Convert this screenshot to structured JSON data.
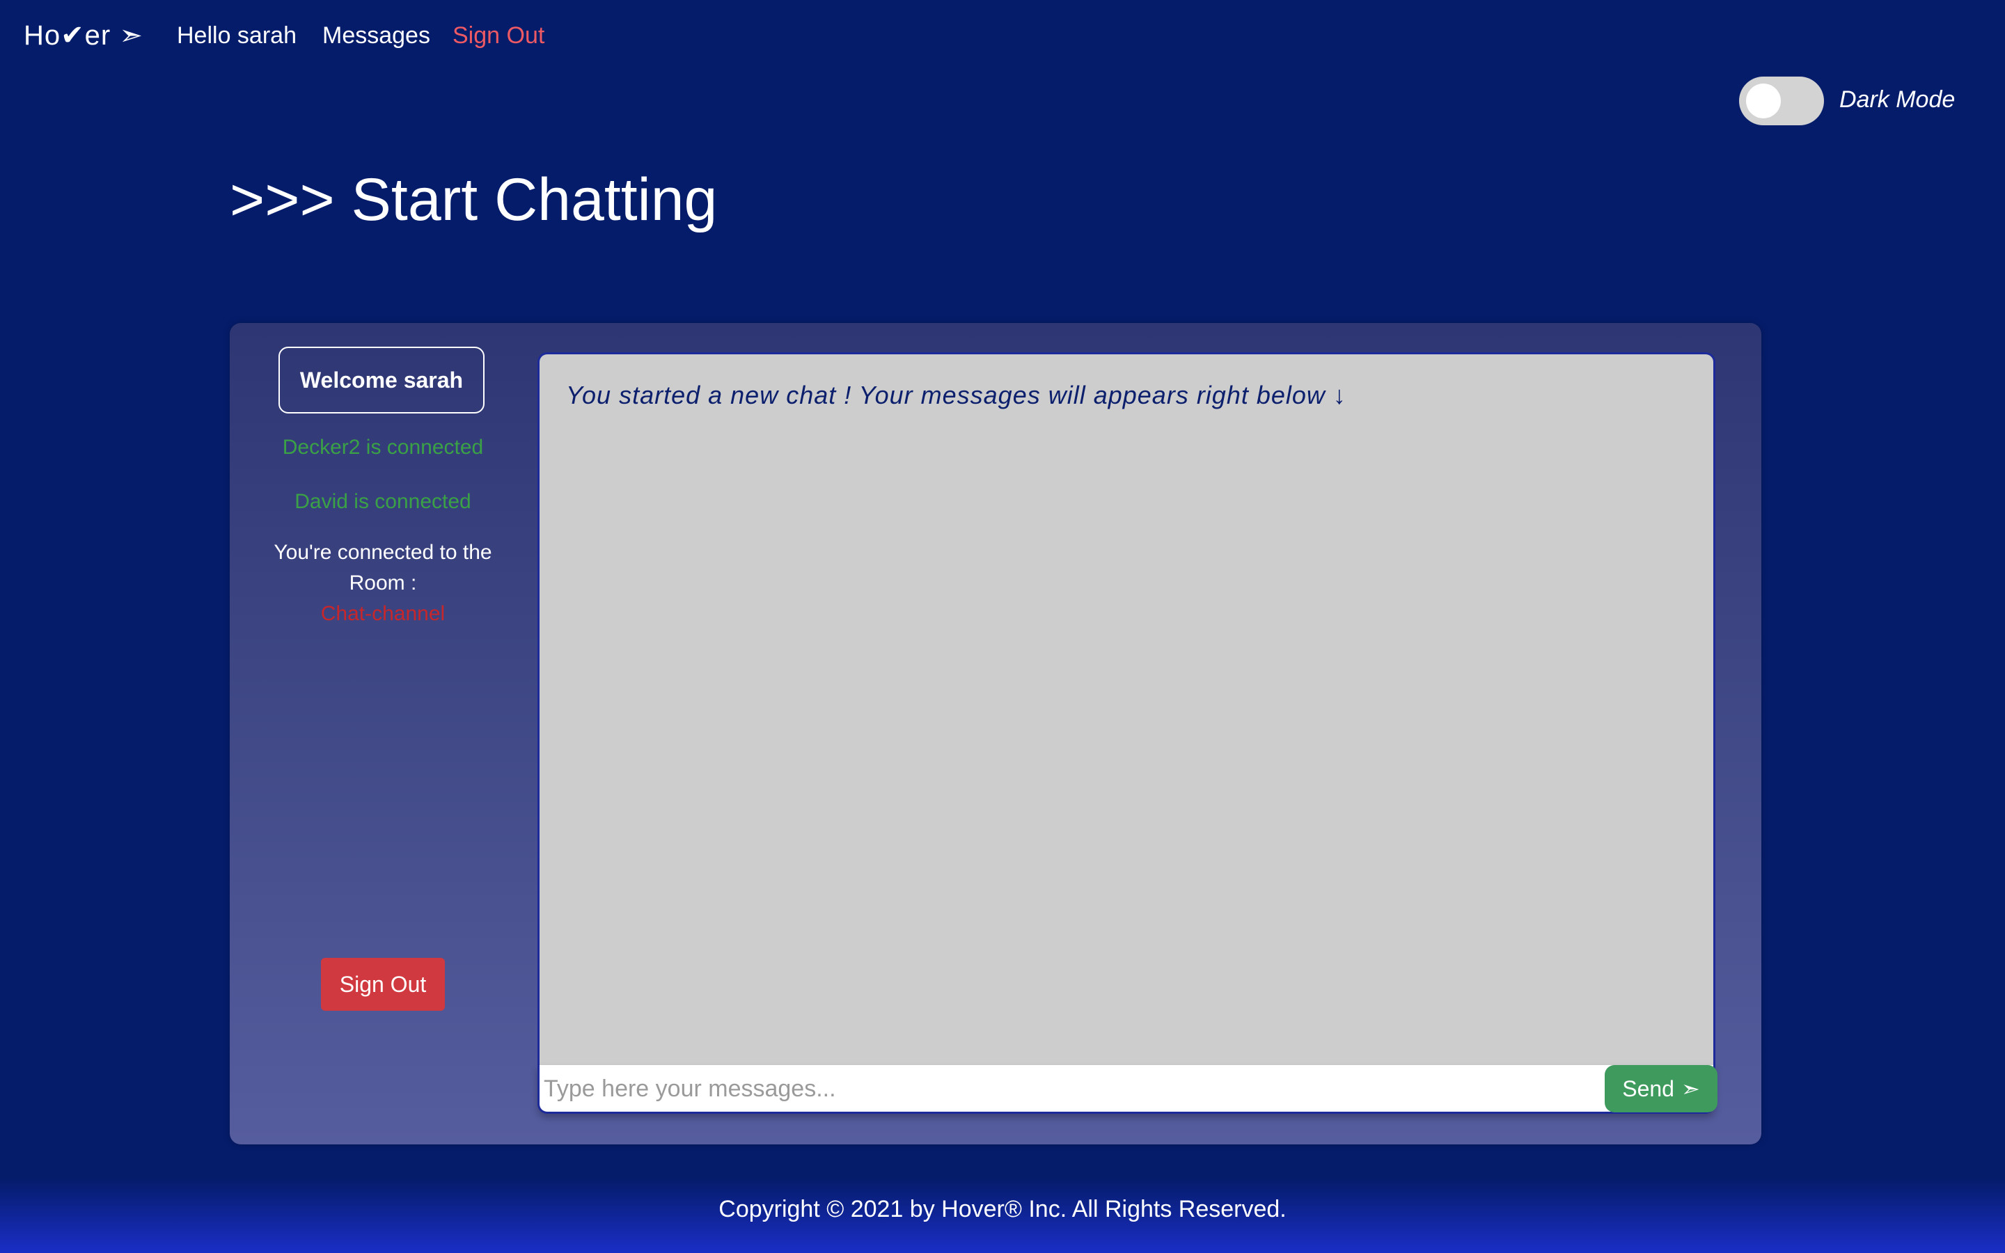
{
  "nav": {
    "brand": "Ho✔er ➣",
    "greeting": "Hello sarah",
    "messages": "Messages",
    "signout": "Sign Out"
  },
  "dark_mode": {
    "label": "Dark Mode",
    "enabled": false
  },
  "page": {
    "title": ">>> Start Chatting"
  },
  "sidebar": {
    "welcome": "Welcome sarah",
    "connected": [
      "Decker2 is connected",
      "David is connected"
    ],
    "room_intro": "You're connected to the Room :",
    "room_name": "Chat-channel",
    "signout_button": "Sign Out"
  },
  "chat": {
    "intro_message": "You started a new chat ! Your messages will appears right below ↓",
    "input_placeholder": "Type here your messages...",
    "send_label": "Send",
    "send_icon": "➣"
  },
  "footer": {
    "copyright": "Copyright © 2021 by Hover® Inc. All Rights Reserved."
  },
  "colors": {
    "background": "#051c6b",
    "signout_link": "#ee5a63",
    "connected_text": "#3aa146",
    "room_name": "#c7262b",
    "signout_button": "#d0393f",
    "send_button": "#3f9a5e",
    "chat_area": "#cdcdcd"
  }
}
